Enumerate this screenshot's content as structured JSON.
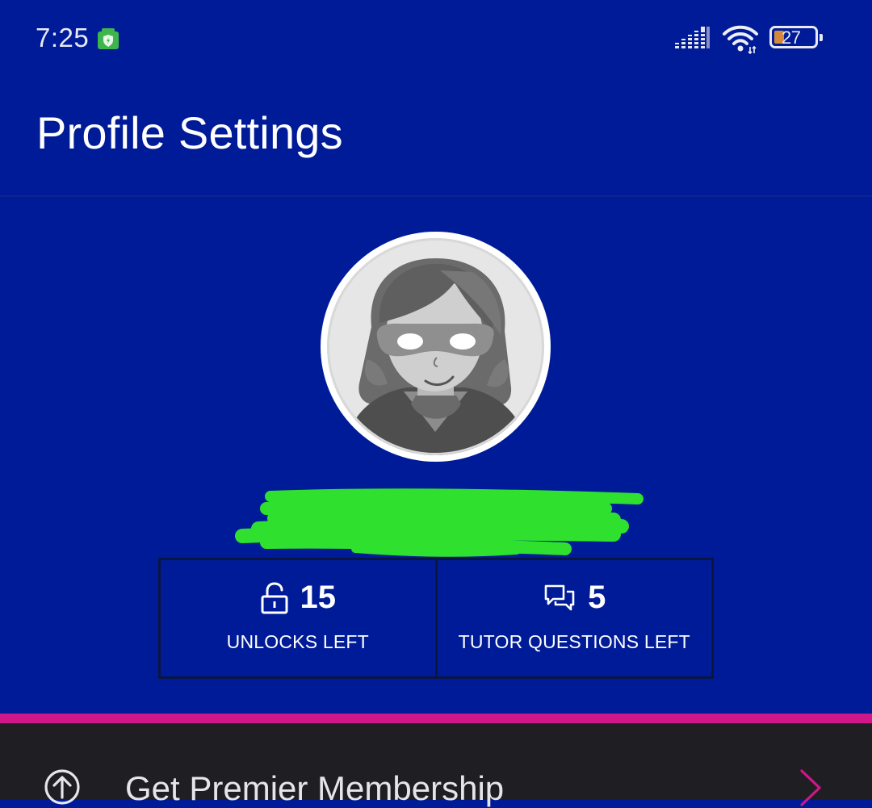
{
  "status_bar": {
    "time": "7:25",
    "battery_percent": "27",
    "icons": [
      "shield-app-icon",
      "signal-icon",
      "wifi-icon",
      "battery-icon"
    ]
  },
  "header": {
    "title": "Profile Settings"
  },
  "profile": {
    "avatar_icon": "masked-avatar"
  },
  "stats": [
    {
      "icon": "unlock-icon",
      "value": "15",
      "label": "UNLOCKS LEFT"
    },
    {
      "icon": "chat-bubbles-icon",
      "value": "5",
      "label": "TUTOR QUESTIONS LEFT"
    }
  ],
  "menu": {
    "items": [
      {
        "icon": "upgrade-arrow-icon",
        "label": "Get Premier Membership",
        "chevron": "chevron-right-icon"
      }
    ]
  },
  "colors": {
    "background": "#001b97",
    "accent": "#d0178a",
    "panel": "#1f1f23",
    "redaction": "#2fe02f"
  }
}
